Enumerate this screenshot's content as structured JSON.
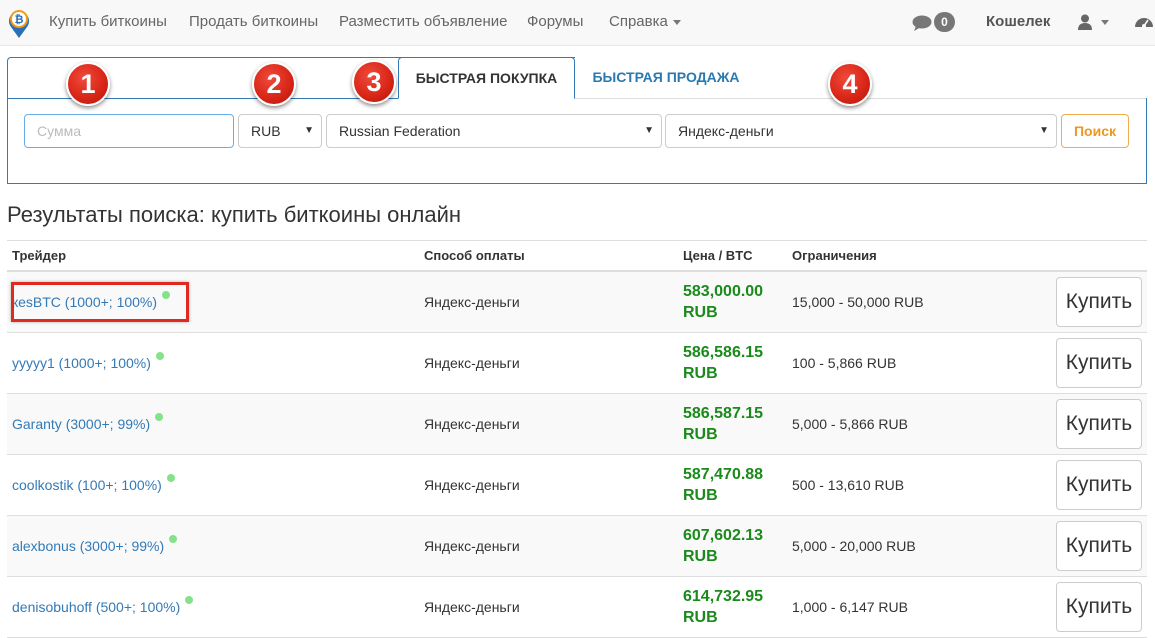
{
  "nav": {
    "items": [
      "Купить биткоины",
      "Продать биткоины",
      "Разместить объявление",
      "Форумы",
      "Справка"
    ],
    "message_count": "0",
    "wallet_label": "Кошелек"
  },
  "tabs": {
    "active": "БЫСТРАЯ ПОКУПКА",
    "inactive": "БЫСТРАЯ ПРОДАЖА"
  },
  "search": {
    "amount_placeholder": "Сумма",
    "currency": "RUB",
    "country": "Russian Federation",
    "payment_method": "Яндекс-деньги",
    "button_label": "Поиск"
  },
  "markers": [
    "1",
    "2",
    "3",
    "4"
  ],
  "results": {
    "title": "Результаты поиска: купить биткоины онлайн",
    "headers": [
      "Трейдер",
      "Способ оплаты",
      "Цена / BTC",
      "Ограничения"
    ],
    "buy_label": "Купить",
    "rows": [
      {
        "trader": "кesBTC (1000+; 100%)",
        "method": "Яндекс-деньги",
        "price": "583,000.00",
        "currency": "RUB",
        "limits": "15,000 - 50,000 RUB"
      },
      {
        "trader": "yyyyy1 (1000+; 100%)",
        "method": "Яндекс-деньги",
        "price": "586,586.15",
        "currency": "RUB",
        "limits": "100 - 5,866 RUB"
      },
      {
        "trader": "Garanty (3000+; 99%)",
        "method": "Яндекс-деньги",
        "price": "586,587.15",
        "currency": "RUB",
        "limits": "5,000 - 5,866 RUB"
      },
      {
        "trader": "coolkostik (100+; 100%)",
        "method": "Яндекс-деньги",
        "price": "587,470.88",
        "currency": "RUB",
        "limits": "500 - 13,610 RUB"
      },
      {
        "trader": "alexbonus (3000+; 99%)",
        "method": "Яндекс-деньги",
        "price": "607,602.13",
        "currency": "RUB",
        "limits": "5,000 - 20,000 RUB"
      },
      {
        "trader": "denisobuhoff (500+; 100%)",
        "method": "Яндекс-деньги",
        "price": "614,732.95",
        "currency": "RUB",
        "limits": "1,000 - 6,147 RUB"
      }
    ]
  },
  "colors": {
    "price_green": "#1a8a1a",
    "link_blue": "#337ab7",
    "marker_red": "#d92718",
    "highlight_red": "#e02a20",
    "search_orange": "#ec971f"
  }
}
